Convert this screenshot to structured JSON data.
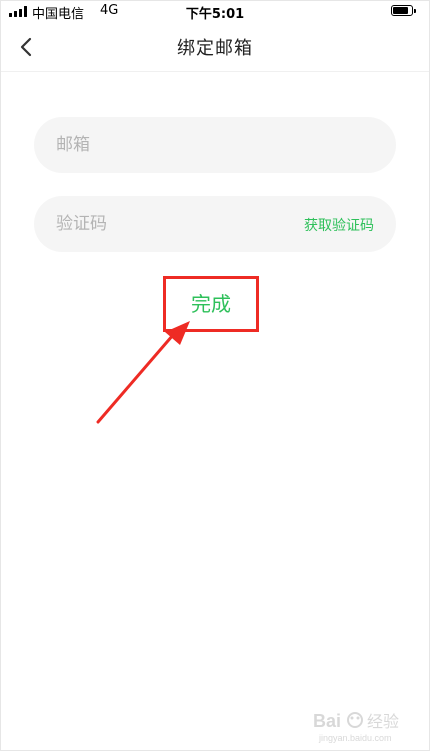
{
  "status_bar": {
    "carrier": "中国电信",
    "network": "4G",
    "time": "下午5:01",
    "signal_bars": 4,
    "battery_level_percent": 85
  },
  "nav": {
    "title": "绑定邮箱",
    "back_icon": "chevron-left-icon"
  },
  "form": {
    "email_placeholder": "邮箱",
    "email_value": "",
    "code_placeholder": "验证码",
    "code_value": "",
    "get_code_label": "获取验证码",
    "done_label": "完成"
  },
  "colors": {
    "accent_green": "#2ec05a",
    "annotation_red": "#ee2b24",
    "field_background": "#f5f5f5",
    "placeholder_gray": "#b4b4b4"
  },
  "watermark": {
    "logo_text": "Bai 经验",
    "url_text": "jingyan.baidu.com"
  }
}
